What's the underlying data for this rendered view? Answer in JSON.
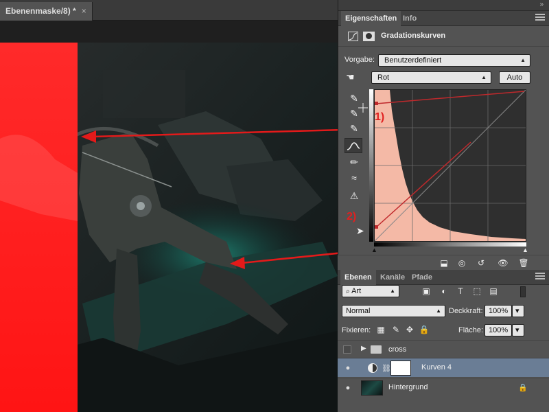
{
  "document": {
    "tab_title": "Ebenenmaske/8) *",
    "tab_close": "×",
    "annotations": [
      "1)",
      "2)"
    ]
  },
  "properties": {
    "tabs": [
      "Eigenschaften",
      "Info"
    ],
    "adjustment_title": "Gradationskurven",
    "preset_label": "Vorgabe:",
    "preset_value": "Benutzerdefiniert",
    "channel_value": "Rot",
    "auto_label": "Auto",
    "collapse_glyph": "»"
  },
  "layers": {
    "tabs": [
      "Ebenen",
      "Kanäle",
      "Pfade"
    ],
    "filter_kind": "Art",
    "blend_mode": "Normal",
    "opacity_label": "Deckkraft:",
    "opacity_value": "100%",
    "lock_label": "Fixieren:",
    "fill_label": "Fläche:",
    "fill_value": "100%",
    "items": [
      {
        "name": "cross",
        "type": "group",
        "visible": false,
        "selected": false
      },
      {
        "name": "Kurven 4",
        "type": "curves",
        "visible": true,
        "selected": true
      },
      {
        "name": "Hintergrund",
        "type": "background",
        "visible": true,
        "selected": false,
        "locked": true
      }
    ]
  },
  "colors": {
    "mask_red": "#ff1a1a",
    "selected_layer": "#6a7d95",
    "histogram_fill": "#f4b9a6"
  }
}
